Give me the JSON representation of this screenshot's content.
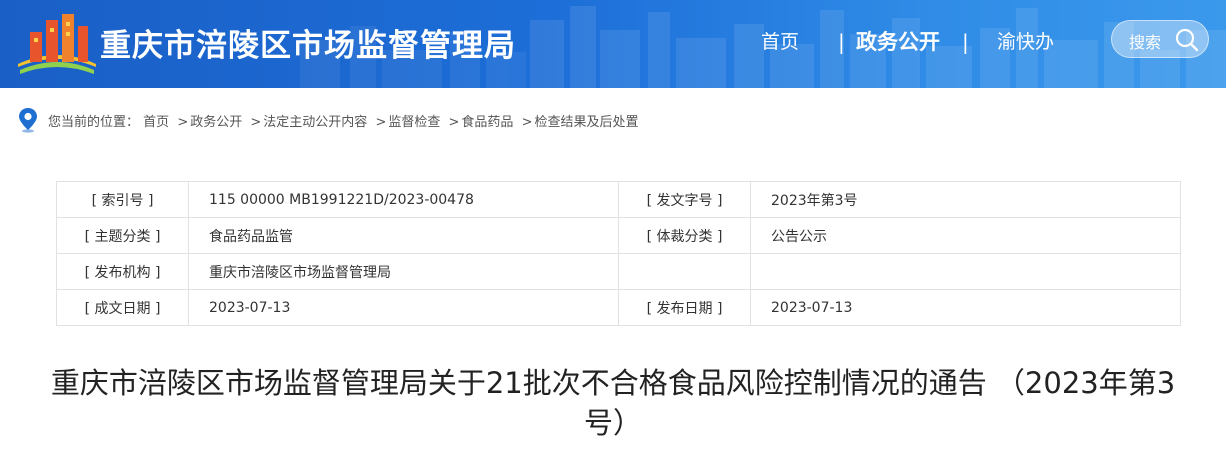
{
  "header": {
    "site_title": "重庆市涪陵区市场监督管理局",
    "nav": [
      {
        "label": "首页"
      },
      {
        "label": "政务公开"
      },
      {
        "label": "渝快办"
      }
    ],
    "separator": "|",
    "search_label": "搜索"
  },
  "breadcrumb": {
    "prefix": "您当前的位置：",
    "items": [
      "首页",
      "政务公开",
      "法定主动公开内容",
      "监督检查",
      "食品药品",
      "检查结果及后处置"
    ],
    "separator": ">"
  },
  "meta": {
    "rows": [
      {
        "k1": "[ 索引号 ]",
        "v1": "115 00000 MB1991221D/2023-00478",
        "k2": "[ 发文字号 ]",
        "v2": "2023年第3号"
      },
      {
        "k1": "[ 主题分类 ]",
        "v1": "食品药品监管",
        "k2": "[ 体裁分类 ]",
        "v2": "公告公示"
      },
      {
        "k1": "[ 发布机构 ]",
        "v1": "重庆市涪陵区市场监督管理局",
        "k2": "",
        "v2": ""
      },
      {
        "k1": "[ 成文日期 ]",
        "v1": "2023-07-13",
        "k2": "[ 发布日期 ]",
        "v2": "2023-07-13"
      }
    ]
  },
  "article": {
    "title": "重庆市涪陵区市场监督管理局关于21批次不合格食品风险控制情况的通告 （2023年第3号）"
  },
  "colors": {
    "header_blue": "#1d6ed8",
    "pin_blue": "#1f6fd0",
    "border": "#e2e2e2"
  },
  "icons": [
    "building-logo-icon",
    "search-icon",
    "location-pin-icon"
  ]
}
